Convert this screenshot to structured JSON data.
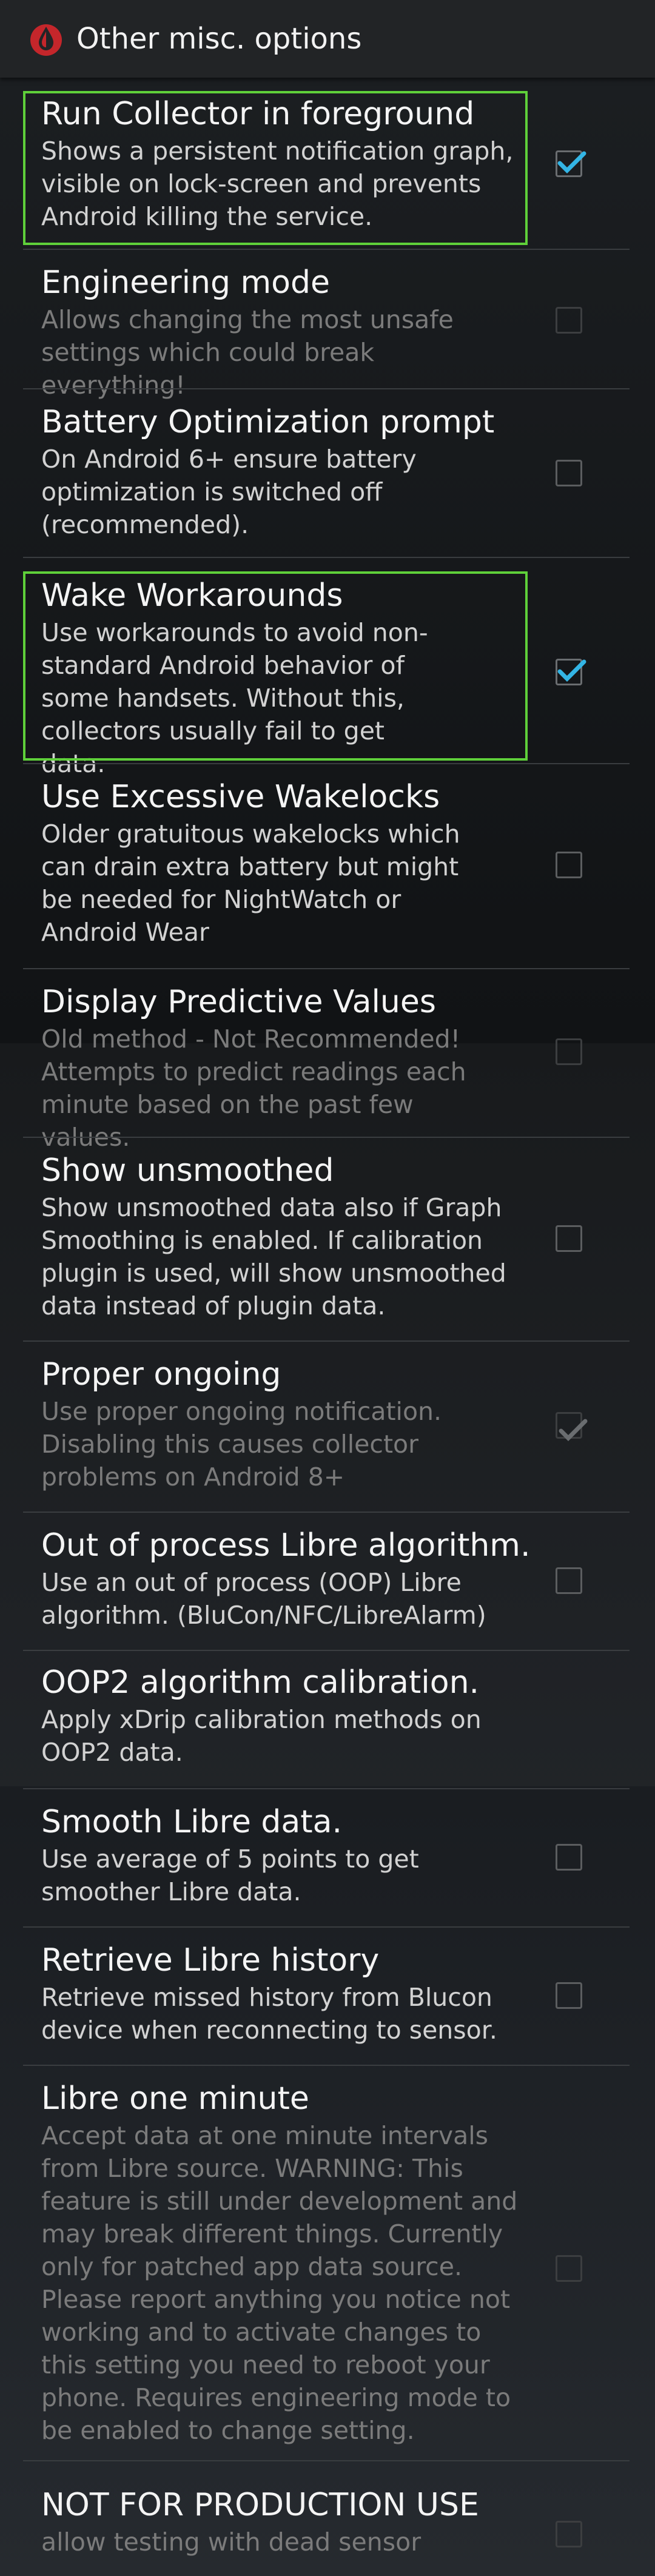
{
  "header": {
    "title": "Other misc. options",
    "icon": "blood-drop-icon"
  },
  "items": [
    {
      "title": "Run Collector in foreground",
      "summary": "Shows a persistent notification graph, visible on lock-screen and prevents Android killing the service.",
      "checked": true,
      "enabled": true,
      "highlighted": true
    },
    {
      "title": "Engineering mode",
      "summary": "Allows changing the most unsafe settings which could break everything!",
      "checked": false,
      "enabled": false,
      "highlighted": false
    },
    {
      "title": "Battery Optimization prompt",
      "summary": "On Android 6+ ensure battery optimization is switched off (recommended).",
      "checked": false,
      "enabled": true,
      "highlighted": false
    },
    {
      "title": "Wake Workarounds",
      "summary": "Use workarounds to avoid non-standard Android behavior of some handsets. Without this, collectors usually fail to get data.",
      "checked": true,
      "enabled": true,
      "highlighted": true
    },
    {
      "title": "Use Excessive Wakelocks",
      "summary": "Older gratuitous wakelocks which can drain extra battery but might be needed for NightWatch or Android Wear",
      "checked": false,
      "enabled": true,
      "highlighted": false
    },
    {
      "title": "Display Predictive Values",
      "summary": "Old method - Not Recommended! Attempts to predict readings each minute based on the past few values.",
      "checked": false,
      "enabled": false,
      "highlighted": false
    },
    {
      "title": "Show unsmoothed",
      "summary": "Show unsmoothed data also if Graph Smoothing is enabled. If calibration plugin is used, will show unsmoothed data instead of plugin data.",
      "checked": false,
      "enabled": true,
      "highlighted": false
    },
    {
      "title": "Proper ongoing",
      "summary": "Use proper ongoing notification. Disabling this causes collector problems on Android 8+",
      "checked": true,
      "enabled": false,
      "highlighted": false
    },
    {
      "title": "Out of process Libre algorithm.",
      "summary": "Use an out of process (OOP) Libre algorithm. (BluCon/NFC/LibreAlarm)",
      "checked": false,
      "enabled": true,
      "highlighted": false
    },
    {
      "title": "OOP2 algorithm calibration.",
      "summary": "Apply xDrip calibration methods on OOP2 data.",
      "checked": null,
      "enabled": true,
      "highlighted": false
    },
    {
      "title": "Smooth Libre data.",
      "summary": "Use average of 5 points to get smoother Libre data.",
      "checked": false,
      "enabled": true,
      "highlighted": false
    },
    {
      "title": "Retrieve Libre history",
      "summary": "Retrieve missed history from Blucon device when reconnecting to sensor.",
      "checked": false,
      "enabled": true,
      "highlighted": false
    },
    {
      "title": "Libre one minute",
      "summary": "Accept data at one minute intervals from Libre source. WARNING: This feature is still under development and may break different things. Currently only for patched app data source. Please report anything you notice not working and to activate changes to this setting you need to reboot your phone. Requires engineering mode to be enabled to change setting.",
      "checked": false,
      "enabled": false,
      "highlighted": false
    },
    {
      "title": "NOT FOR PRODUCTION USE",
      "summary": "allow testing with dead sensor",
      "checked": false,
      "enabled": false,
      "highlighted": false
    }
  ]
}
